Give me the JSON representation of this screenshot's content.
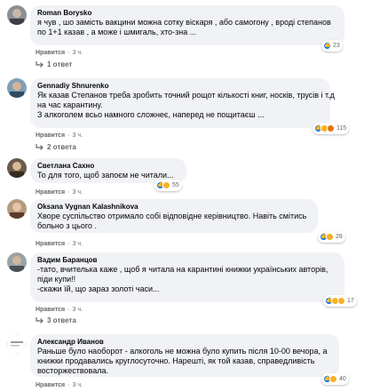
{
  "comments": [
    {
      "author": "Roman Borysko",
      "lines": [
        "я чув , шо замість вакцини можна сотку віскаря , або самогону , вроді степанов",
        "по 1+1 казав , а може і шмигаль, хто-зна ..."
      ],
      "like_label": "Нравится",
      "time": "3 ч.",
      "reactions_count": "23",
      "reply_label": "1 ответ"
    },
    {
      "author": "Gennadiy Shnurenko",
      "lines": [
        "Як казав Степанов треба зробить точний рощот кількості книг, носків, трусів і т.д",
        "на час карантину.",
        "З алкоголем всьо намного сложнеє, наперед не пощитаєш ..."
      ],
      "like_label": "Нравится",
      "time": "3 ч.",
      "reactions_count": "115",
      "reply_label": "2 ответа"
    },
    {
      "author": "Светлана Сахно",
      "lines": [
        "То для того, щоб запоєм не читали..."
      ],
      "like_label": "Нравится",
      "time": "3 ч.",
      "reactions_count": "55"
    },
    {
      "author": "Oksana Vygnan Kalashnikova",
      "lines": [
        "Хворе суспільство отримало собі відповідне керівництво. Навіть смітись",
        "больно з цього ."
      ],
      "like_label": "Нравится",
      "time": "3 ч.",
      "reactions_count": "28"
    },
    {
      "author": "Вадим Баранцов",
      "lines": [
        "-тато, вчителька каже , щоб я читала на карантині книжки українських авторів,",
        "піди купи!!",
        "-скажи їй, що зараз золоті часи..."
      ],
      "like_label": "Нравится",
      "time": "3 ч.",
      "reactions_count": "17",
      "reply_label": "3 ответа"
    },
    {
      "author": "Александр Иванов",
      "lines": [
        "Раньше було наоборот - алкоголь не можна було купить після 10-00 вечора, а",
        "книжки продавались круглосуточно. Нарешті, як той казав, справедливість",
        "восторжествовала."
      ],
      "like_label": "Нравится",
      "time": "3 ч.",
      "reactions_count": "40"
    }
  ],
  "colors": {
    "bubble": "#f0f2f5",
    "meta": "#65676b",
    "like_blue": "#1877f2",
    "haha_yellow": "#f7b125"
  },
  "icons": [
    "reply-arrow-icon",
    "like-reaction-icon",
    "haha-reaction-icon",
    "sad-reaction-icon"
  ]
}
